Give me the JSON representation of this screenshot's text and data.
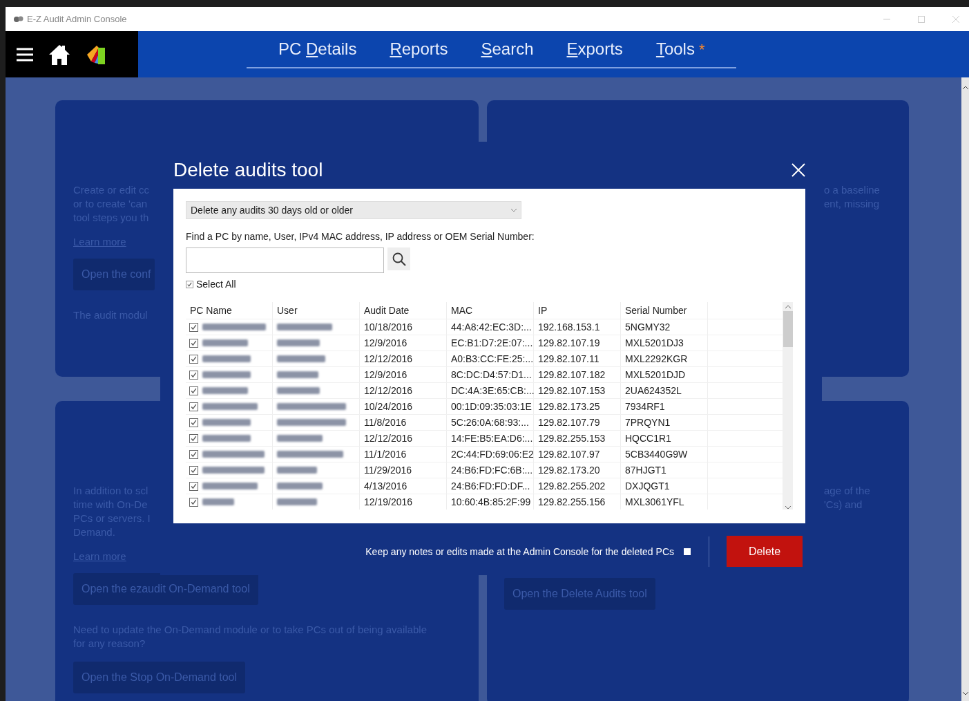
{
  "window": {
    "title": "E-Z Audit Admin Console"
  },
  "nav": {
    "tabs": [
      {
        "before": "PC ",
        "key": "D",
        "after": "etails"
      },
      {
        "key": "R",
        "after": "eports"
      },
      {
        "key": "S",
        "after": "earch"
      },
      {
        "key": "E",
        "after": "xports"
      },
      {
        "key": "T",
        "after": "ools",
        "badge": "*"
      }
    ]
  },
  "background_cards": [
    {
      "lines": [
        "Create or edit cc",
        "or to create 'can",
        "tool steps you th"
      ],
      "link": "Learn more",
      "button": "Open the conf",
      "note": [
        "The audit modul"
      ]
    },
    {
      "lines": [
        "o a baseline",
        "ent, missing"
      ]
    },
    {
      "lines": [
        "In addition to scl",
        "time with On-De",
        "PCs or servers. I",
        "Demand."
      ],
      "link": "Learn more",
      "button": "Open the ezaudit On-Demand tool",
      "note": [
        "Need to update the On-Demand module or to take PCs out of being available",
        "for any reason?"
      ],
      "button_2": "Open the Stop On-Demand tool"
    },
    {
      "lines": [
        "age of the",
        "'Cs) and"
      ],
      "button": "Open the Delete Audits tool"
    }
  ],
  "dialog": {
    "title": "Delete audits tool",
    "age_filter": {
      "value": "Delete any audits 30 days old or older"
    },
    "search_label": "Find a PC by name, User, IPv4 MAC address, IP address or OEM Serial Number:",
    "select_all": {
      "label": "Select All",
      "checked": true
    },
    "table": {
      "columns": [
        "PC Name",
        "User",
        "Audit Date",
        "MAC",
        "IP",
        "Serial Number"
      ],
      "rows": [
        {
          "checked": true,
          "audit_date": "10/18/2016",
          "mac": "44:A8:42:EC:3D:...",
          "ip": "192.168.153.1",
          "serial": "5NGMY32"
        },
        {
          "checked": true,
          "audit_date": "12/9/2016",
          "mac": "EC:B1:D7:2E:07:...",
          "ip": "129.82.107.19",
          "serial": "MXL5201DJ3"
        },
        {
          "checked": true,
          "audit_date": "12/12/2016",
          "mac": "A0:B3:CC:FE:25:...",
          "ip": "129.82.107.11",
          "serial": "MXL2292KGR"
        },
        {
          "checked": true,
          "audit_date": "12/9/2016",
          "mac": "8C:DC:D4:57:D1...",
          "ip": "129.82.107.182",
          "serial": "MXL5201DJD"
        },
        {
          "checked": true,
          "audit_date": "12/12/2016",
          "mac": "DC:4A:3E:65:CB:...",
          "ip": "129.82.107.153",
          "serial": "2UA624352L"
        },
        {
          "checked": true,
          "audit_date": "10/24/2016",
          "mac": "00:1D:09:35:03:1E",
          "ip": "129.82.173.25",
          "serial": "7934RF1"
        },
        {
          "checked": true,
          "audit_date": "11/8/2016",
          "mac": "5C:26:0A:68:93:...",
          "ip": "129.82.107.79",
          "serial": "7PRQYN1"
        },
        {
          "checked": true,
          "audit_date": "12/12/2016",
          "mac": "14:FE:B5:EA:D6:...",
          "ip": "129.82.255.153",
          "serial": "HQCC1R1"
        },
        {
          "checked": true,
          "audit_date": "11/1/2016",
          "mac": "2C:44:FD:69:06:E2",
          "ip": "129.82.107.97",
          "serial": "5CB3440G9W"
        },
        {
          "checked": true,
          "audit_date": "11/29/2016",
          "mac": "24:B6:FD:FC:6B:...",
          "ip": "129.82.173.20",
          "serial": "87HJGT1"
        },
        {
          "checked": true,
          "audit_date": "4/13/2016",
          "mac": "24:B6:FD:FD:DF...",
          "ip": "129.82.255.202",
          "serial": "DXJQGT1"
        },
        {
          "checked": true,
          "audit_date": "12/19/2016",
          "mac": "10:60:4B:85:2F:99",
          "ip": "129.82.255.156",
          "serial": "MXL3061YFL"
        }
      ]
    },
    "keep_notes": {
      "label": "Keep any notes or edits made at the Admin Console for the deleted PCs",
      "checked": false
    },
    "delete_button": "Delete"
  }
}
